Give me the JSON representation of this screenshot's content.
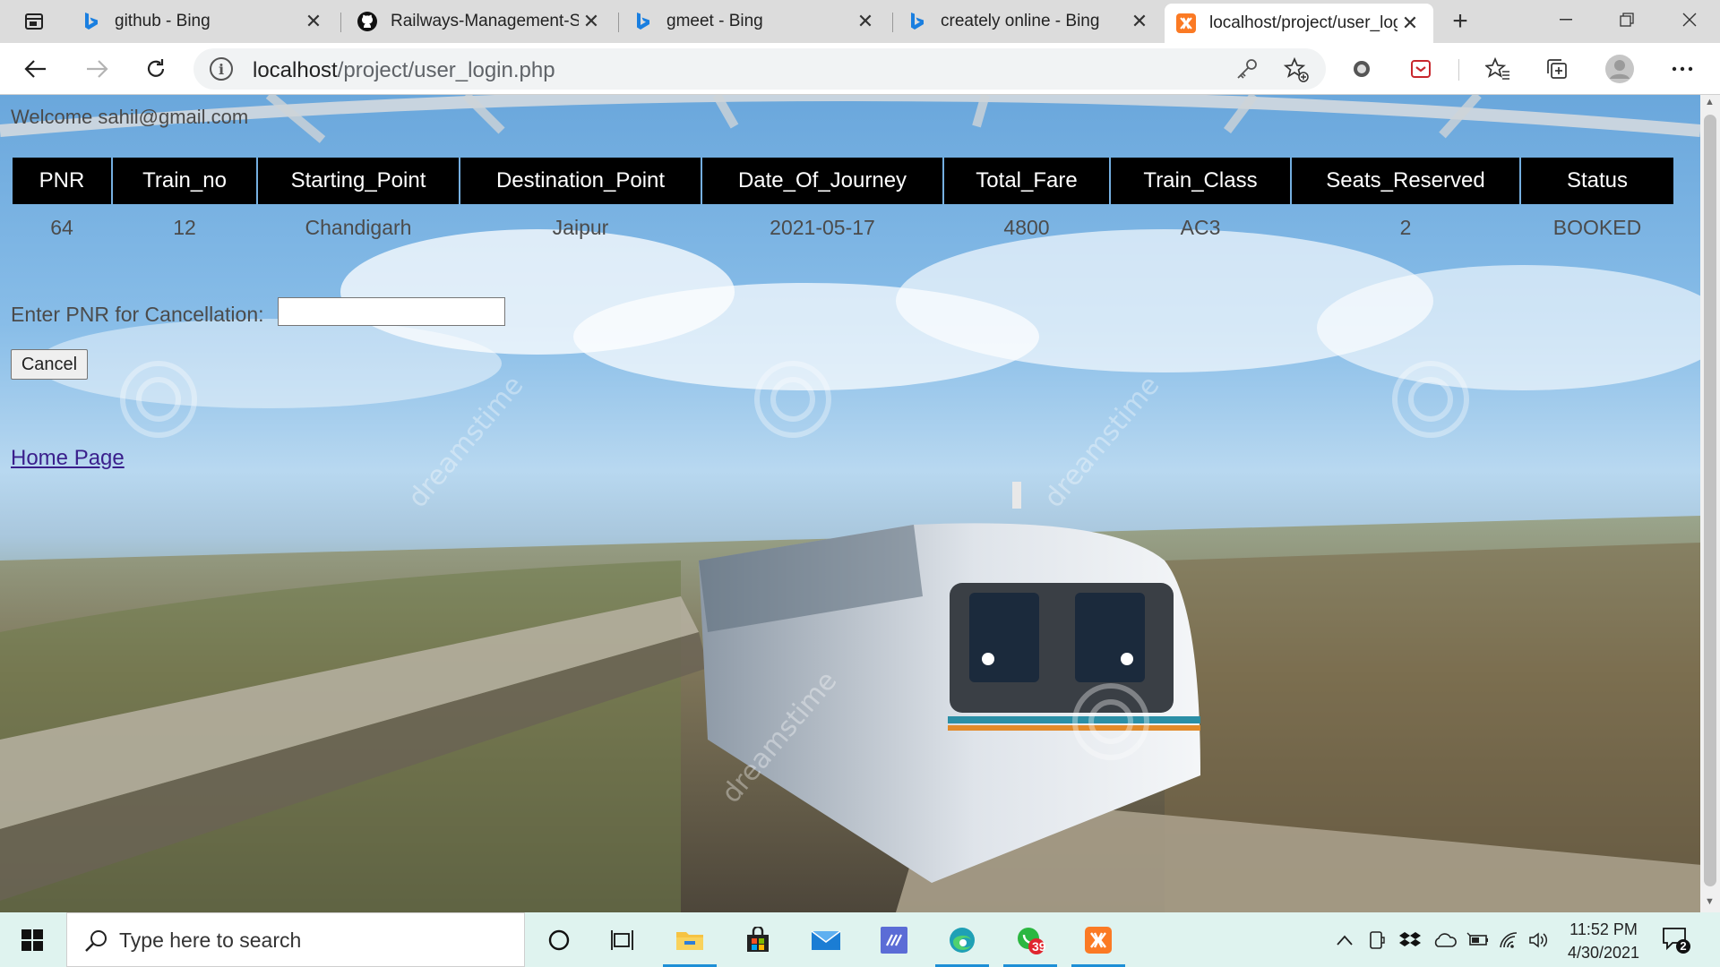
{
  "browser": {
    "tabs": [
      {
        "title": "github - Bing",
        "icon": "bing-icon"
      },
      {
        "title": "Railways-Management-Sy",
        "icon": "github-icon"
      },
      {
        "title": "gmeet - Bing",
        "icon": "bing-icon"
      },
      {
        "title": "creately online - Bing",
        "icon": "bing-icon"
      },
      {
        "title": "localhost/project/user_log",
        "icon": "xampp-icon",
        "active": true
      }
    ],
    "url_host": "localhost",
    "url_path": "/project/user_login.php"
  },
  "page": {
    "welcome": "Welcome sahil@gmail.com",
    "table": {
      "headers": [
        "PNR",
        "Train_no",
        "Starting_Point",
        "Destination_Point",
        "Date_Of_Journey",
        "Total_Fare",
        "Train_Class",
        "Seats_Reserved",
        "Status"
      ],
      "rows": [
        [
          "64",
          "12",
          "Chandigarh",
          "Jaipur",
          "2021-05-17",
          "4800",
          "AC3",
          "2",
          "BOOKED"
        ]
      ]
    },
    "cancel_label": "Enter PNR for Cancellation:",
    "cancel_input_value": "",
    "cancel_button": "Cancel",
    "home_link": "Home Page",
    "watermark": "dreamstime"
  },
  "taskbar": {
    "search_placeholder": "Type here to search",
    "whatsapp_badge": "39",
    "time": "11:52 PM",
    "date": "4/30/2021",
    "notification_count": "2"
  },
  "colors": {
    "header_bg": "#000000",
    "header_text": "#ffffff",
    "link": "#3a1f8c",
    "taskbar_bg": "#dff3ef"
  }
}
